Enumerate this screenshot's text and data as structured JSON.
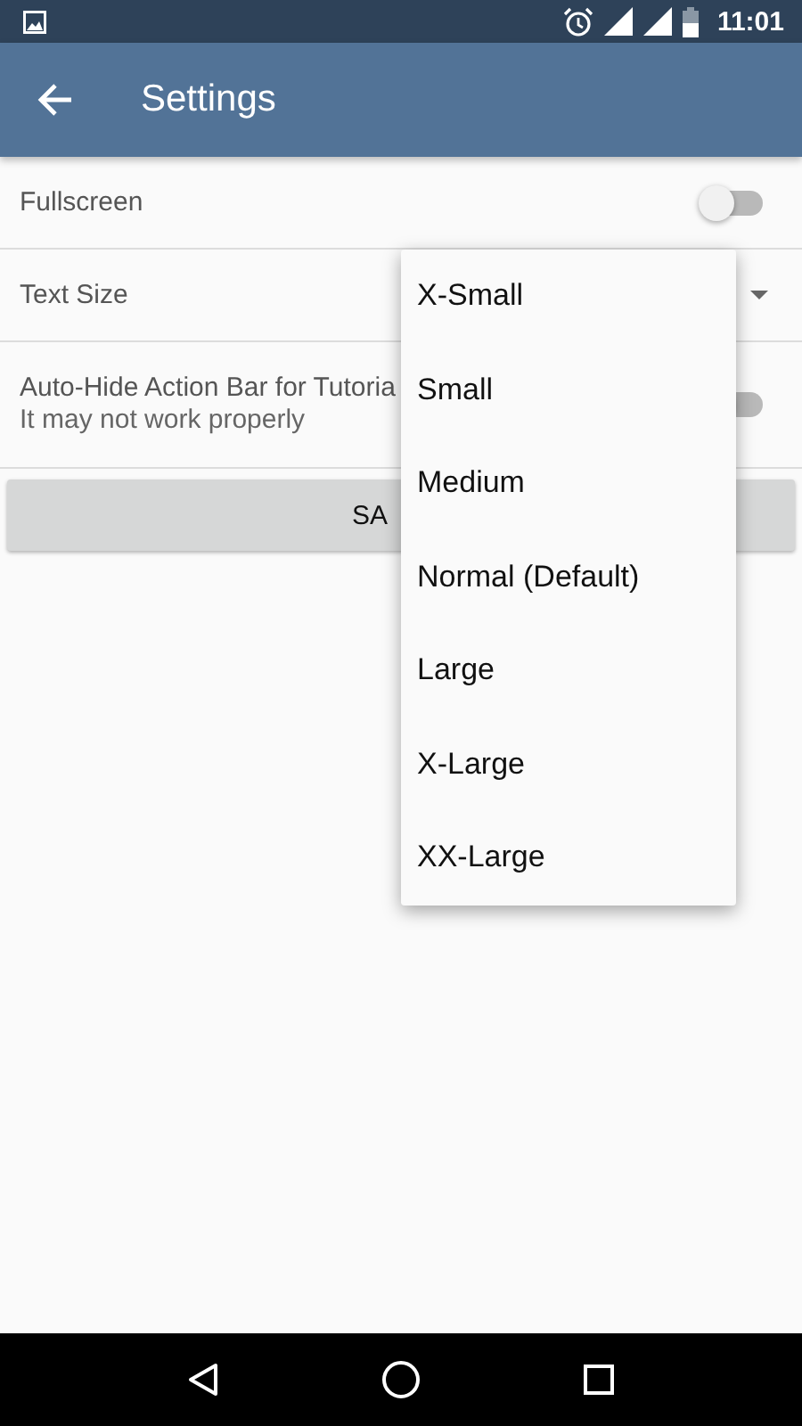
{
  "status_bar": {
    "time": "11:01"
  },
  "app_bar": {
    "title": "Settings"
  },
  "settings": [
    {
      "kind": "switch",
      "label": "Fullscreen",
      "checked": false
    },
    {
      "kind": "dropdown",
      "label": "Text Size"
    },
    {
      "kind": "switch",
      "label": "Auto-Hide Action Bar for Tutoria",
      "summary": "It may not work properly",
      "checked": false
    }
  ],
  "save_button": {
    "label": "SA"
  },
  "dropdown_menu": {
    "options": [
      "X-Small",
      "Small",
      "Medium",
      "Normal (Default)",
      "Large",
      "X-Large",
      "XX-Large"
    ]
  }
}
